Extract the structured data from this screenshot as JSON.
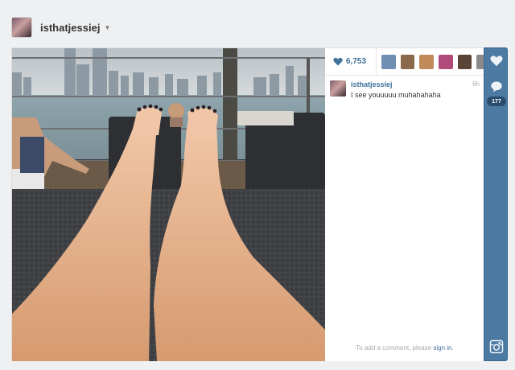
{
  "header": {
    "username": "isthatjessiej",
    "caret_icon": "chevron-down-icon"
  },
  "post": {
    "like_count": "6,753",
    "likers": [
      {
        "color": "#6f8fb2"
      },
      {
        "color": "#8a6a4a"
      },
      {
        "color": "#c08a5a"
      },
      {
        "color": "#b04a7a"
      },
      {
        "color": "#5a4438"
      },
      {
        "color": "#8b8b8b"
      }
    ],
    "caption": {
      "username": "isthatjessiej",
      "time": "6h",
      "text": "I see youuuuu muhahahaha"
    },
    "add_comment_prefix": "To add a comment, please ",
    "sign_in_label": "sign in",
    "add_comment_suffix": "."
  },
  "rail": {
    "comment_count": "177",
    "icons": [
      "heart-icon",
      "speech-bubble-icon",
      "instagram-icon"
    ]
  },
  "colors": {
    "accent": "#3f729b",
    "rail": "#4d7aa3"
  }
}
